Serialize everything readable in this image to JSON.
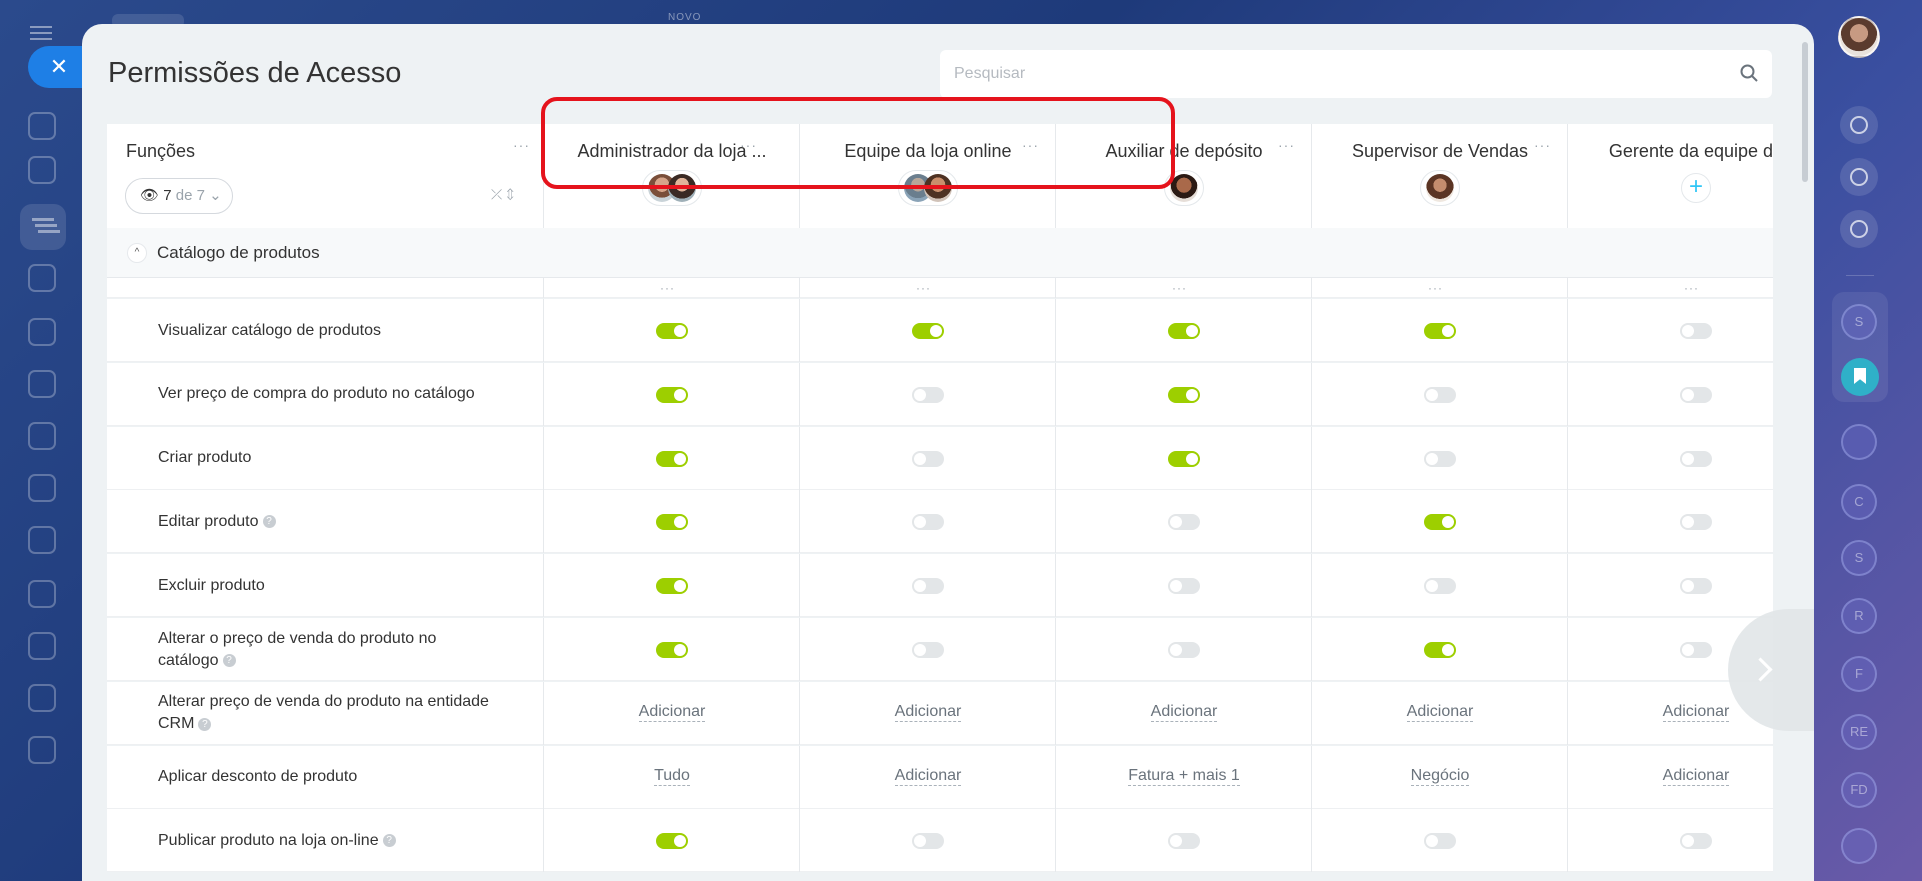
{
  "app": {
    "top_label": "NOVO",
    "page_title": "Permissões de Acesso"
  },
  "search": {
    "placeholder": "Pesquisar",
    "value": ""
  },
  "left_rail": {
    "icons": [
      "menu-icon",
      "close-icon",
      "connections-icon",
      "tasks-icon",
      "filter-icon",
      "goals-icon",
      "cart-icon",
      "id-card-icon",
      "robot-icon",
      "box-icon",
      "warehouse-icon",
      "calendar-icon",
      "analytics-icon",
      "settings-icon",
      "document-icon"
    ]
  },
  "right_rail": {
    "letters": [
      "S",
      "C",
      "S",
      "R",
      "F",
      "RE",
      "FD"
    ]
  },
  "table": {
    "functions_header": "Funções",
    "filter": {
      "count": "7",
      "of_label": "de 7"
    },
    "roles": [
      {
        "name": "Administrador da loja ...",
        "avatars": [
          "a1",
          "a2"
        ]
      },
      {
        "name": "Equipe da loja online",
        "avatars": [
          "a3",
          "a4"
        ]
      },
      {
        "name": "Auxiliar de depósito",
        "avatars": [
          "a5"
        ]
      },
      {
        "name": "Supervisor de Vendas",
        "avatars": [
          "a6"
        ]
      },
      {
        "name": "Gerente da equipe de",
        "avatars": []
      }
    ],
    "section": {
      "title": "Catálogo de produtos"
    },
    "rows": [
      {
        "label": "Visualizar catálogo de produtos",
        "help": false,
        "cells": [
          {
            "kind": "toggle",
            "on": true
          },
          {
            "kind": "toggle",
            "on": true
          },
          {
            "kind": "toggle",
            "on": true
          },
          {
            "kind": "toggle",
            "on": true
          },
          {
            "kind": "toggle",
            "on": false
          }
        ]
      },
      {
        "label": "Ver preço de compra do produto no catálogo",
        "help": false,
        "cells": [
          {
            "kind": "toggle",
            "on": true
          },
          {
            "kind": "toggle",
            "on": false
          },
          {
            "kind": "toggle",
            "on": true
          },
          {
            "kind": "toggle",
            "on": false
          },
          {
            "kind": "toggle",
            "on": false
          }
        ]
      },
      {
        "label": "Criar produto",
        "help": false,
        "cells": [
          {
            "kind": "toggle",
            "on": true
          },
          {
            "kind": "toggle",
            "on": false
          },
          {
            "kind": "toggle",
            "on": true
          },
          {
            "kind": "toggle",
            "on": false
          },
          {
            "kind": "toggle",
            "on": false
          }
        ]
      },
      {
        "label": "Editar produto",
        "help": true,
        "cells": [
          {
            "kind": "toggle",
            "on": true
          },
          {
            "kind": "toggle",
            "on": false
          },
          {
            "kind": "toggle",
            "on": false
          },
          {
            "kind": "toggle",
            "on": true
          },
          {
            "kind": "toggle",
            "on": false
          }
        ]
      },
      {
        "label": "Excluir produto",
        "help": false,
        "cells": [
          {
            "kind": "toggle",
            "on": true
          },
          {
            "kind": "toggle",
            "on": false
          },
          {
            "kind": "toggle",
            "on": false
          },
          {
            "kind": "toggle",
            "on": false
          },
          {
            "kind": "toggle",
            "on": false
          }
        ]
      },
      {
        "label": "Alterar o preço de venda do produto no catálogo",
        "help": true,
        "cells": [
          {
            "kind": "toggle",
            "on": true
          },
          {
            "kind": "toggle",
            "on": false
          },
          {
            "kind": "toggle",
            "on": false
          },
          {
            "kind": "toggle",
            "on": true
          },
          {
            "kind": "toggle",
            "on": false
          }
        ]
      },
      {
        "label": "Alterar preço de venda do produto na entidade CRM",
        "help": true,
        "cells": [
          {
            "kind": "text",
            "value": "Adicionar"
          },
          {
            "kind": "text",
            "value": "Adicionar"
          },
          {
            "kind": "text",
            "value": "Adicionar"
          },
          {
            "kind": "text",
            "value": "Adicionar"
          },
          {
            "kind": "text",
            "value": "Adicionar"
          }
        ]
      },
      {
        "label": "Aplicar desconto de produto",
        "help": false,
        "cells": [
          {
            "kind": "text",
            "value": "Tudo"
          },
          {
            "kind": "text",
            "value": "Adicionar"
          },
          {
            "kind": "text",
            "value": "Fatura + mais 1"
          },
          {
            "kind": "text",
            "value": "Negócio"
          },
          {
            "kind": "text",
            "value": "Adicionar"
          }
        ]
      },
      {
        "label": "Publicar produto na loja on-line",
        "help": true,
        "cells": [
          {
            "kind": "toggle",
            "on": true
          },
          {
            "kind": "toggle",
            "on": false
          },
          {
            "kind": "toggle",
            "on": false
          },
          {
            "kind": "toggle",
            "on": false
          },
          {
            "kind": "toggle",
            "on": false
          }
        ]
      }
    ]
  },
  "colors": {
    "toggle_on": "#9dcf00",
    "toggle_off": "#e3e6e8",
    "accent": "#1e7fe6",
    "highlight": "#e5131c"
  }
}
